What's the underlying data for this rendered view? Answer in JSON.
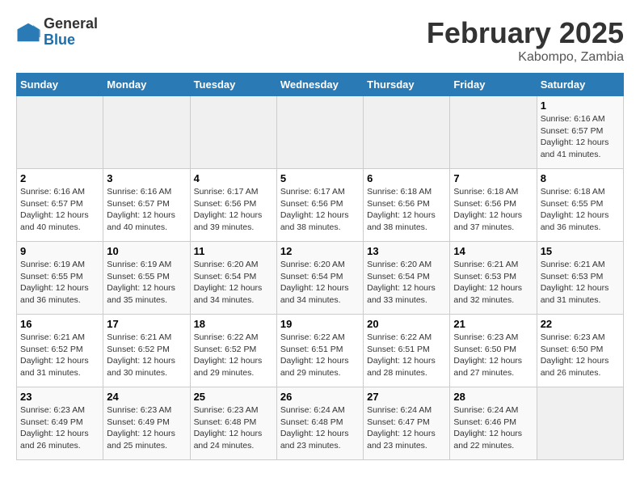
{
  "logo": {
    "general": "General",
    "blue": "Blue"
  },
  "title": "February 2025",
  "location": "Kabompo, Zambia",
  "days_of_week": [
    "Sunday",
    "Monday",
    "Tuesday",
    "Wednesday",
    "Thursday",
    "Friday",
    "Saturday"
  ],
  "weeks": [
    [
      {
        "day": "",
        "info": ""
      },
      {
        "day": "",
        "info": ""
      },
      {
        "day": "",
        "info": ""
      },
      {
        "day": "",
        "info": ""
      },
      {
        "day": "",
        "info": ""
      },
      {
        "day": "",
        "info": ""
      },
      {
        "day": "1",
        "info": "Sunrise: 6:16 AM\nSunset: 6:57 PM\nDaylight: 12 hours and 41 minutes."
      }
    ],
    [
      {
        "day": "2",
        "info": "Sunrise: 6:16 AM\nSunset: 6:57 PM\nDaylight: 12 hours and 40 minutes."
      },
      {
        "day": "3",
        "info": "Sunrise: 6:16 AM\nSunset: 6:57 PM\nDaylight: 12 hours and 40 minutes."
      },
      {
        "day": "4",
        "info": "Sunrise: 6:17 AM\nSunset: 6:56 PM\nDaylight: 12 hours and 39 minutes."
      },
      {
        "day": "5",
        "info": "Sunrise: 6:17 AM\nSunset: 6:56 PM\nDaylight: 12 hours and 38 minutes."
      },
      {
        "day": "6",
        "info": "Sunrise: 6:18 AM\nSunset: 6:56 PM\nDaylight: 12 hours and 38 minutes."
      },
      {
        "day": "7",
        "info": "Sunrise: 6:18 AM\nSunset: 6:56 PM\nDaylight: 12 hours and 37 minutes."
      },
      {
        "day": "8",
        "info": "Sunrise: 6:18 AM\nSunset: 6:55 PM\nDaylight: 12 hours and 36 minutes."
      }
    ],
    [
      {
        "day": "9",
        "info": "Sunrise: 6:19 AM\nSunset: 6:55 PM\nDaylight: 12 hours and 36 minutes."
      },
      {
        "day": "10",
        "info": "Sunrise: 6:19 AM\nSunset: 6:55 PM\nDaylight: 12 hours and 35 minutes."
      },
      {
        "day": "11",
        "info": "Sunrise: 6:20 AM\nSunset: 6:54 PM\nDaylight: 12 hours and 34 minutes."
      },
      {
        "day": "12",
        "info": "Sunrise: 6:20 AM\nSunset: 6:54 PM\nDaylight: 12 hours and 34 minutes."
      },
      {
        "day": "13",
        "info": "Sunrise: 6:20 AM\nSunset: 6:54 PM\nDaylight: 12 hours and 33 minutes."
      },
      {
        "day": "14",
        "info": "Sunrise: 6:21 AM\nSunset: 6:53 PM\nDaylight: 12 hours and 32 minutes."
      },
      {
        "day": "15",
        "info": "Sunrise: 6:21 AM\nSunset: 6:53 PM\nDaylight: 12 hours and 31 minutes."
      }
    ],
    [
      {
        "day": "16",
        "info": "Sunrise: 6:21 AM\nSunset: 6:52 PM\nDaylight: 12 hours and 31 minutes."
      },
      {
        "day": "17",
        "info": "Sunrise: 6:21 AM\nSunset: 6:52 PM\nDaylight: 12 hours and 30 minutes."
      },
      {
        "day": "18",
        "info": "Sunrise: 6:22 AM\nSunset: 6:52 PM\nDaylight: 12 hours and 29 minutes."
      },
      {
        "day": "19",
        "info": "Sunrise: 6:22 AM\nSunset: 6:51 PM\nDaylight: 12 hours and 29 minutes."
      },
      {
        "day": "20",
        "info": "Sunrise: 6:22 AM\nSunset: 6:51 PM\nDaylight: 12 hours and 28 minutes."
      },
      {
        "day": "21",
        "info": "Sunrise: 6:23 AM\nSunset: 6:50 PM\nDaylight: 12 hours and 27 minutes."
      },
      {
        "day": "22",
        "info": "Sunrise: 6:23 AM\nSunset: 6:50 PM\nDaylight: 12 hours and 26 minutes."
      }
    ],
    [
      {
        "day": "23",
        "info": "Sunrise: 6:23 AM\nSunset: 6:49 PM\nDaylight: 12 hours and 26 minutes."
      },
      {
        "day": "24",
        "info": "Sunrise: 6:23 AM\nSunset: 6:49 PM\nDaylight: 12 hours and 25 minutes."
      },
      {
        "day": "25",
        "info": "Sunrise: 6:23 AM\nSunset: 6:48 PM\nDaylight: 12 hours and 24 minutes."
      },
      {
        "day": "26",
        "info": "Sunrise: 6:24 AM\nSunset: 6:48 PM\nDaylight: 12 hours and 23 minutes."
      },
      {
        "day": "27",
        "info": "Sunrise: 6:24 AM\nSunset: 6:47 PM\nDaylight: 12 hours and 23 minutes."
      },
      {
        "day": "28",
        "info": "Sunrise: 6:24 AM\nSunset: 6:46 PM\nDaylight: 12 hours and 22 minutes."
      },
      {
        "day": "",
        "info": ""
      }
    ]
  ]
}
